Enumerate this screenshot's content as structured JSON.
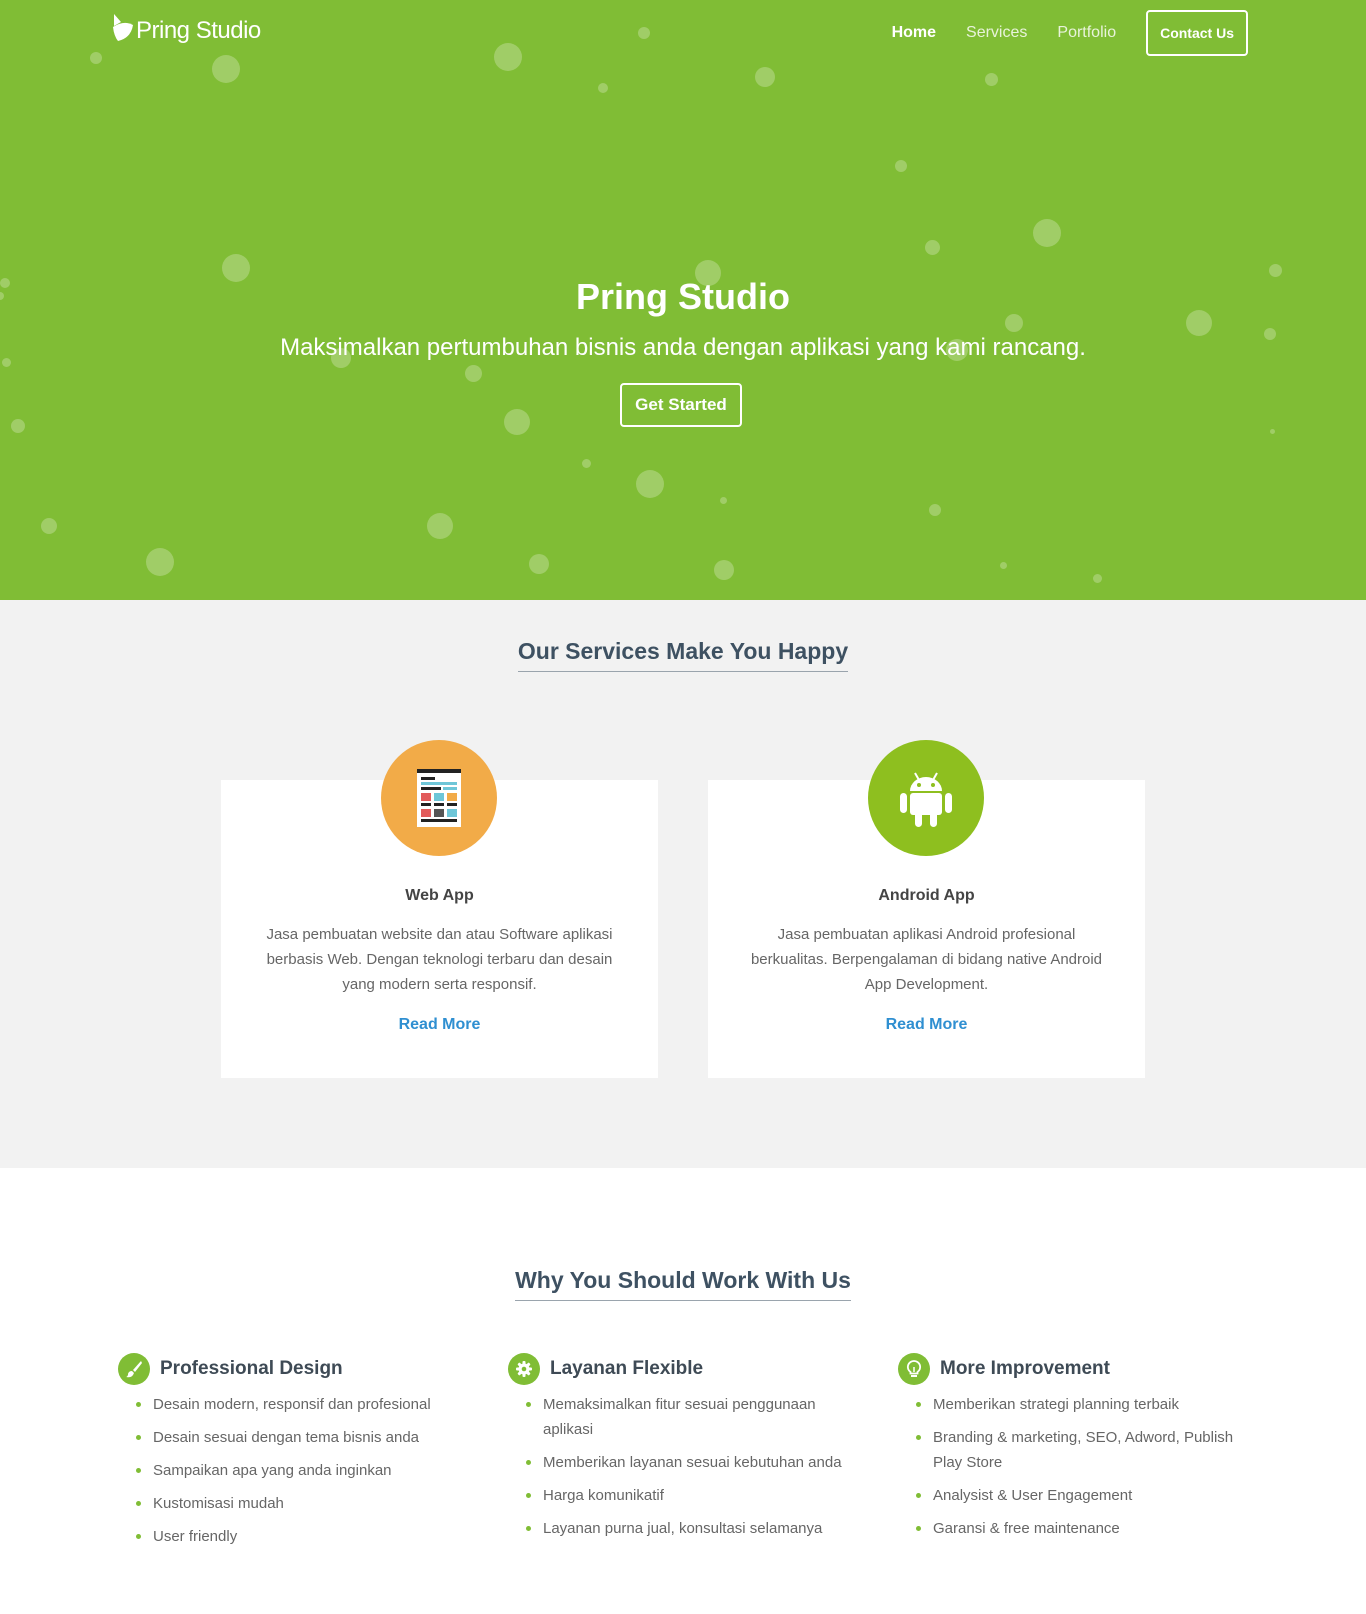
{
  "colors": {
    "brand_green": "#80bd35",
    "web_app_orange": "#f2ab48",
    "android_green": "#8ebf1f",
    "link_blue": "#2f8fd1",
    "heading": "#3e5162"
  },
  "nav": {
    "brand": "Pring Studio",
    "logo_icon": "leaf-logo-icon",
    "links": [
      "Home",
      "Services",
      "Portfolio"
    ],
    "contact": "Contact Us"
  },
  "hero": {
    "title": "Pring Studio",
    "subtitle": "Maksimalkan pertumbuhan bisnis anda dengan aplikasi yang kami rancang.",
    "cta": "Get Started"
  },
  "services": {
    "heading": "Our Services Make You Happy",
    "cards": [
      {
        "icon": "web-app-icon",
        "title": "Web App",
        "description": "Jasa pembuatan website dan atau Software aplikasi berbasis Web. Dengan teknologi terbaru dan desain yang modern serta responsif.",
        "link": "Read More"
      },
      {
        "icon": "android-icon",
        "title": "Android App",
        "description": "Jasa pembuatan aplikasi Android profesional berkualitas. Berpengalaman di bidang native Android App Development.",
        "link": "Read More"
      }
    ]
  },
  "why": {
    "heading": "Why You Should Work With Us",
    "columns": [
      {
        "icon": "paintbrush-icon",
        "title": "Professional Design",
        "items": [
          "Desain modern, responsif dan profesional",
          "Desain sesuai dengan tema bisnis anda",
          "Sampaikan apa yang anda inginkan",
          "Kustomisasi mudah",
          "User friendly"
        ]
      },
      {
        "icon": "gear-icon",
        "title": "Layanan Flexible",
        "items": [
          "Memaksimalkan fitur sesuai penggunaan aplikasi",
          "Memberikan layanan sesuai kebutuhan anda",
          "Harga komunikatif",
          "Layanan purna jual, konsultasi selamanya"
        ]
      },
      {
        "icon": "lightbulb-icon",
        "title": "More Improvement",
        "items": [
          "Memberikan strategi planning terbaik",
          "Branding & marketing, SEO, Adword, Publish Play Store",
          "Analysist & User Engagement",
          "Garansi & free maintenance"
        ]
      }
    ]
  }
}
